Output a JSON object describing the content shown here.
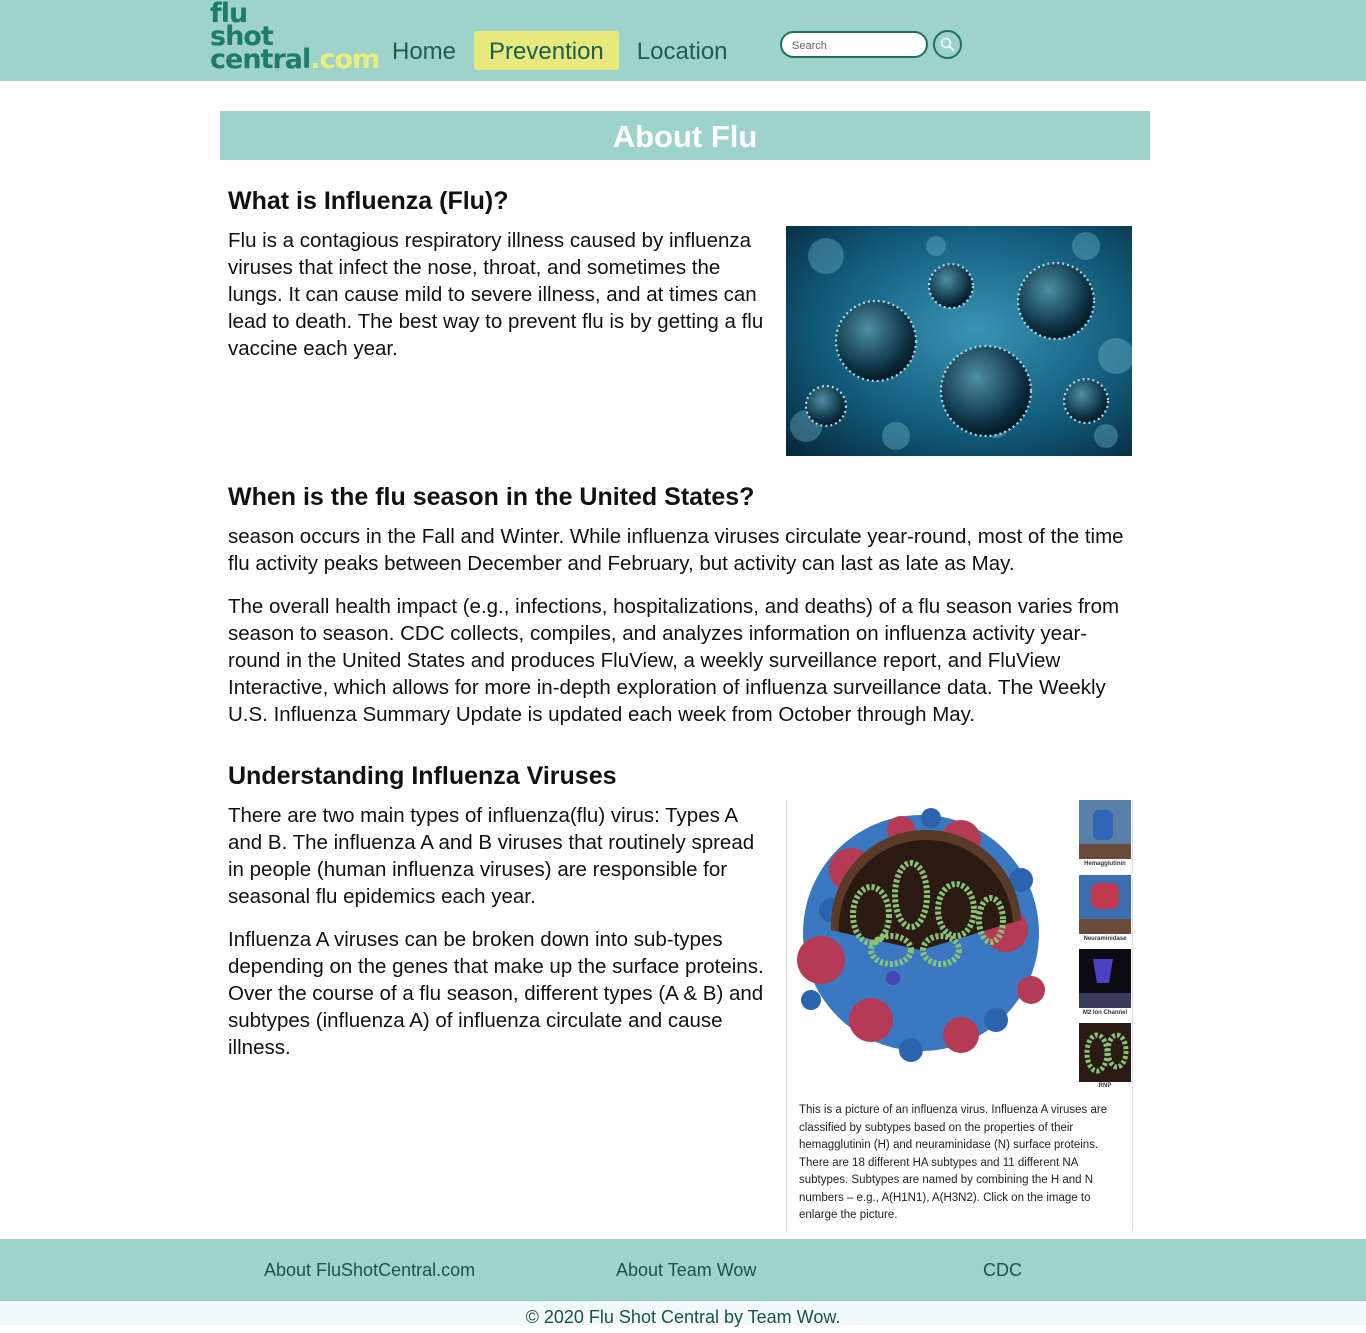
{
  "header": {
    "logo": {
      "line1": "flu",
      "line2": "shot",
      "line3_main": "central",
      "line3_suffix": ".com"
    },
    "nav": [
      {
        "label": "Home",
        "active": false
      },
      {
        "label": "Prevention",
        "active": true
      },
      {
        "label": "Location",
        "active": false
      }
    ],
    "search": {
      "placeholder": "Search"
    }
  },
  "banner": {
    "title": "About Flu"
  },
  "sections": [
    {
      "heading": "What is Influenza (Flu)?",
      "paragraphs": [
        "Flu is a contagious respiratory illness caused by influenza viruses that infect the nose, throat, and sometimes the lungs. It can cause mild to severe illness, and at times can lead to death. The best way to prevent flu is by getting a flu vaccine each year."
      ]
    },
    {
      "heading": "When is the flu season in the United States?",
      "paragraphs": [
        "season occurs in the Fall and Winter. While influenza viruses circulate year-round, most of the time flu activity peaks between December and February, but activity can last as late as May.",
        "The overall health impact (e.g., infections, hospitalizations, and deaths) of a flu season varies from season to season. CDC collects, compiles, and analyzes information on influenza activity year-round in the United States and produces FluView, a weekly surveillance report, and FluView Interactive, which allows for more in-depth exploration of influenza surveillance data. The Weekly U.S. Influenza Summary Update is updated each week from October through May."
      ]
    },
    {
      "heading": "Understanding Influenza Viruses",
      "paragraphs": [
        "There are two main types of influenza(flu) virus: Types A and B. The influenza A and B viruses that routinely spread in people (human influenza viruses) are responsible for seasonal flu epidemics each year.",
        "Influenza A viruses can be broken down into sub-types depending on the genes that make up the surface proteins. Over the course of a flu season, different types (A & B) and subtypes (influenza A) of influenza circulate and cause illness."
      ]
    }
  ],
  "diagram": {
    "labels": [
      "Hemagglutinin",
      "Neuraminidase",
      "M2 Ion Channel",
      "RNP"
    ],
    "caption": "This is a picture of an influenza virus. Influenza A viruses are classified by subtypes based on the properties of their hemagglutinin (H) and neuraminidase (N) surface proteins. There are 18 different HA subtypes and 11 different NA subtypes. Subtypes are named by combining the H and N numbers – e.g., A(H1N1), A(H3N2). Click on the image to enlarge the picture."
  },
  "footer": {
    "links": [
      "About FluShotCentral.com",
      "About Team Wow",
      "CDC"
    ],
    "copyright": "© 2020 Flu Shot Central by Team Wow."
  },
  "colors": {
    "header_bg": "#9dd3cb",
    "active_nav": "#e8e97c",
    "logo_green": "#1f7a68",
    "logo_yellow": "#ecec7a"
  }
}
